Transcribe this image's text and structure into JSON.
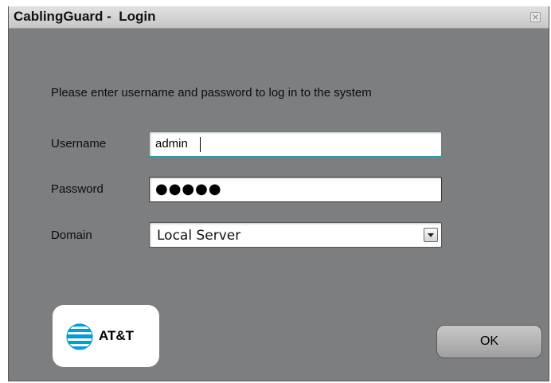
{
  "window": {
    "title": "CablingGuard -  Login",
    "close_icon": "close-icon"
  },
  "form": {
    "prompt": "Please enter username and password to log in to the system",
    "username_label": "Username",
    "username_value": "admin",
    "password_label": "Password",
    "password_masked": "●●●●●",
    "domain_label": "Domain",
    "domain_value": "Local Server",
    "domain_arrow_icon": "chevron-down-icon"
  },
  "logo": {
    "text": "AT&T",
    "globe_icon": "att-globe-icon",
    "globe_color": "#009fdb"
  },
  "actions": {
    "ok_label": "OK"
  }
}
